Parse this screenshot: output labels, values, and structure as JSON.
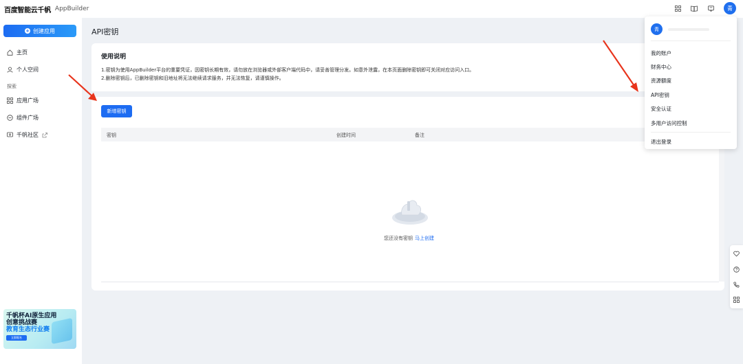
{
  "topbar": {
    "logo": "百度智能云千帆",
    "product": "AppBuilder",
    "avatar_text": "青"
  },
  "sidebar": {
    "create_label": "创建应用",
    "items": [
      {
        "label": "主页"
      },
      {
        "label": "个人空间"
      },
      {
        "label": "应用广场"
      },
      {
        "label": "组件广场"
      },
      {
        "label": "千帆社区"
      }
    ],
    "section_label": "探索",
    "banner": {
      "line1": "千帆杯AI原生应用",
      "line2": "创意挑战赛",
      "line3": "教育生态行业赛",
      "button": "立即报名"
    }
  },
  "main": {
    "page_title": "API密钥",
    "instructions": {
      "title": "使用说明",
      "lines": [
        "1.密钥为使用AppBuilder平台的重要凭证，因密钥长期有效，请勿放在浏览器或外部客户端代码中，请妥善管理分发。如意外泄露，在本页面删除密钥即可关闭对应访问入口。",
        "2.删除密钥后，已删除密钥和旧地址将无法继续请求服务，并无法恢复，请谨慎操作。"
      ]
    },
    "new_key_label": "新增密钥",
    "table": {
      "columns": [
        "密钥",
        "创建时间",
        "备注"
      ]
    },
    "empty": {
      "text": "您还没有密钥",
      "link": "马上创建"
    }
  },
  "dropdown": {
    "avatar_text": "青",
    "items": [
      "我的账户",
      "财务中心",
      "资源额度",
      "API密钥",
      "安全认证",
      "多用户访问控制"
    ],
    "logout": "退出登录"
  },
  "colors": {
    "primary": "#1d6cf2",
    "background": "#eef1f5",
    "arrow": "#e8341c"
  }
}
